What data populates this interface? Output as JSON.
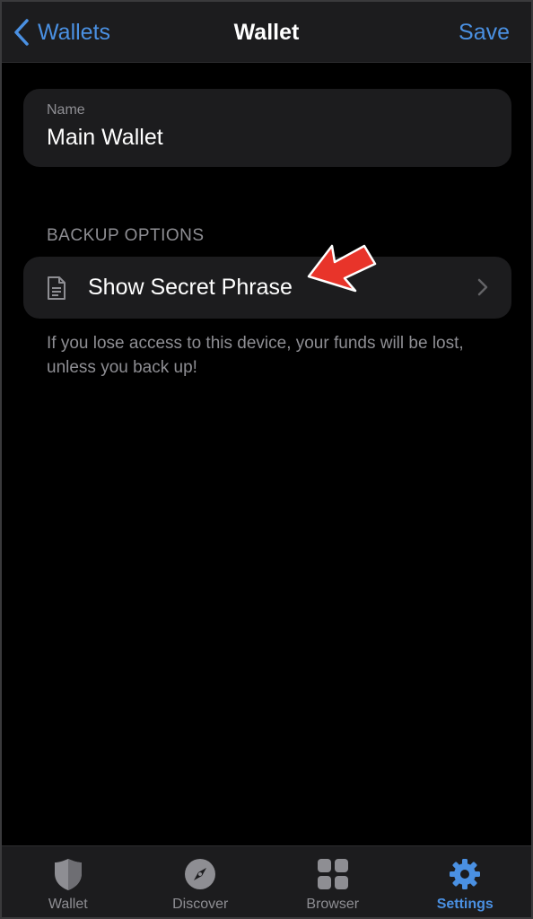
{
  "colors": {
    "accent": "#4a90e2",
    "background": "#000000",
    "card": "#1c1c1e",
    "secondary_text": "#8e8e93",
    "annotation_arrow": "#e8342a"
  },
  "navbar": {
    "back_label": "Wallets",
    "back_icon": "chevron-left-icon",
    "title": "Wallet",
    "save_label": "Save"
  },
  "name_field": {
    "label": "Name",
    "value": "Main Wallet"
  },
  "backup": {
    "section_header": "BACKUP OPTIONS",
    "option_icon": "document-icon",
    "option_label": "Show Secret Phrase",
    "option_chevron": "chevron-right-icon",
    "footnote": "If you lose access to this device, your funds will be lost, unless you back up!"
  },
  "tabbar": {
    "tabs": [
      {
        "label": "Wallet",
        "icon": "shield-icon",
        "active": false
      },
      {
        "label": "Discover",
        "icon": "compass-icon",
        "active": false
      },
      {
        "label": "Browser",
        "icon": "grid-icon",
        "active": false
      },
      {
        "label": "Settings",
        "icon": "gear-icon",
        "active": true
      }
    ]
  }
}
